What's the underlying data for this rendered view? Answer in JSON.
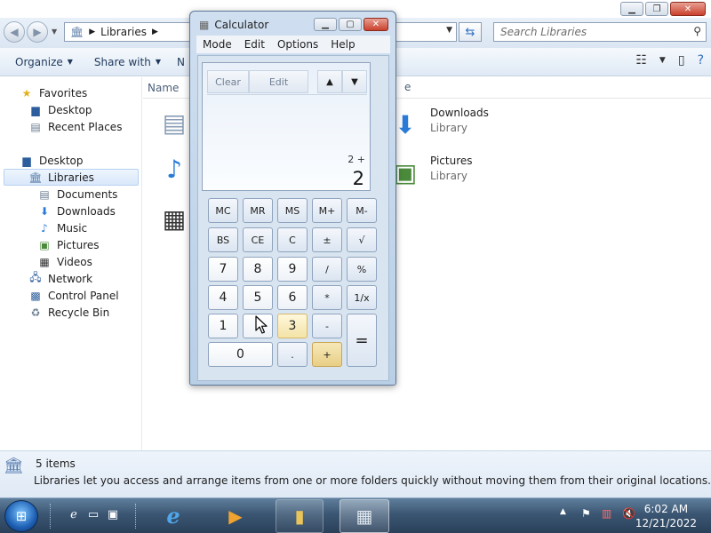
{
  "explorer": {
    "address": {
      "root_icon": "libraries-icon",
      "segment": "Libraries"
    },
    "search_placeholder": "Search Libraries",
    "commands": {
      "organize": "Organize",
      "share_with": "Share with",
      "new_truncated": "N"
    },
    "nav": {
      "favorites": "Favorites",
      "desktop_fav": "Desktop",
      "recent_places": "Recent Places",
      "desktop": "Desktop",
      "libraries": "Libraries",
      "documents": "Documents",
      "downloads": "Downloads",
      "music": "Music",
      "pictures": "Pictures",
      "videos": "Videos",
      "network": "Network",
      "control_panel": "Control Panel",
      "recycle_bin": "Recycle Bin"
    },
    "column_header": {
      "name": "Name",
      "second_fragment": "e"
    },
    "items": [
      {
        "name": "Downloads",
        "sub": "Library"
      },
      {
        "name": "Pictures",
        "sub": "Library"
      }
    ],
    "details": {
      "count": "5 items",
      "description": "Libraries let you access and arrange items from one or more folders quickly without moving them from their original locations."
    }
  },
  "calculator": {
    "title": "Calculator",
    "menu": [
      "Mode",
      "Edit",
      "Options",
      "Help"
    ],
    "history": {
      "clear": "Clear",
      "edit": "Edit",
      "up": "▲",
      "down": "▼"
    },
    "expression": "2 +",
    "value": "2",
    "keys": {
      "mc": "MC",
      "mr": "MR",
      "ms": "MS",
      "mplus": "M+",
      "mminus": "M-",
      "bs": "BS",
      "ce": "CE",
      "c": "C",
      "plusminus": "±",
      "sqrt": "√",
      "k7": "7",
      "k8": "8",
      "k9": "9",
      "div": "/",
      "pct": "%",
      "k4": "4",
      "k5": "5",
      "k6": "6",
      "mul": "*",
      "recip": "1/x",
      "k1": "1",
      "k2": "",
      "k3": "3",
      "sub": "-",
      "k0": "0",
      "dot": ".",
      "add": "+",
      "eq": "="
    }
  },
  "taskbar": {
    "clock_time": "6:02 AM",
    "clock_date": "12/21/2022"
  }
}
